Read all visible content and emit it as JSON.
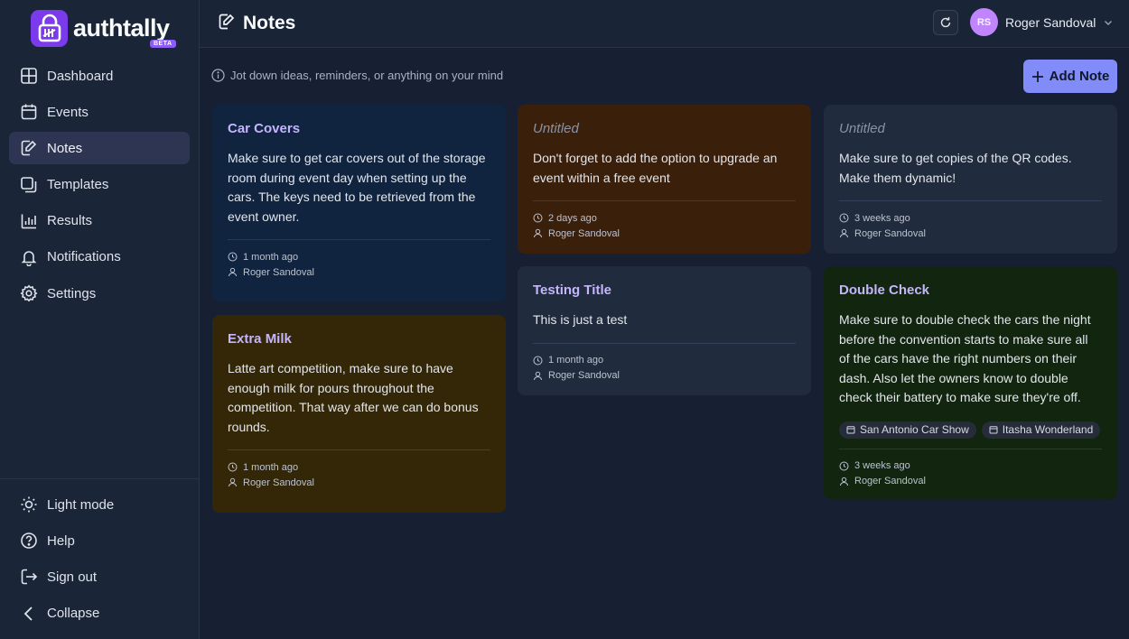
{
  "brand": {
    "name": "authtally",
    "badge": "BETA",
    "accent": "#7c3aed"
  },
  "sidebar": {
    "items": [
      {
        "label": "Dashboard",
        "icon": "dashboard-icon"
      },
      {
        "label": "Events",
        "icon": "calendar-icon"
      },
      {
        "label": "Notes",
        "icon": "notes-icon",
        "active": true
      },
      {
        "label": "Templates",
        "icon": "templates-icon"
      },
      {
        "label": "Results",
        "icon": "bar-chart-icon"
      },
      {
        "label": "Notifications",
        "icon": "bell-icon"
      },
      {
        "label": "Settings",
        "icon": "gear-icon"
      }
    ],
    "bottom": [
      {
        "label": "Light mode",
        "icon": "sun-icon"
      },
      {
        "label": "Help",
        "icon": "help-icon"
      },
      {
        "label": "Sign out",
        "icon": "sign-out-icon"
      },
      {
        "label": "Collapse",
        "icon": "chevron-left-icon"
      }
    ]
  },
  "header": {
    "title": "Notes",
    "user": {
      "initials": "RS",
      "name": "Roger Sandoval"
    }
  },
  "subheader": {
    "hint": "Jot down ideas, reminders, or anything on your mind",
    "add_label": "Add Note"
  },
  "notes": [
    {
      "title": "Car Covers",
      "body": "Make sure to get car covers out of the storage room during event day when setting up the cars. The keys need to be retrieved from the event owner.",
      "time": "1 month ago",
      "author": "Roger Sandoval",
      "color": "#10233f"
    },
    {
      "title": "Extra Milk",
      "body": "Latte art competition, make sure to have enough milk for pours throughout the competition. That way after we can do bonus rounds.",
      "time": "1 month ago",
      "author": "Roger Sandoval",
      "color": "#342708"
    },
    {
      "title": "Untitled",
      "body": "Don't forget to add the option to upgrade an event within a free event",
      "time": "2 days ago",
      "author": "Roger Sandoval",
      "color": "#3a1f0b"
    },
    {
      "title": "Testing Title",
      "body": "This is just a test",
      "time": "1 month ago",
      "author": "Roger Sandoval",
      "color": "#202b3d"
    },
    {
      "title": "Untitled",
      "body": "Make sure to get copies of the QR codes. Make them dynamic!",
      "time": "3 weeks ago",
      "author": "Roger Sandoval",
      "color": "#202b3d"
    },
    {
      "title": "Double Check",
      "body": "Make sure to double check the cars the night before the convention starts to make sure all of the cars have the right numbers on their dash. Also let the owners know to double check their battery to make sure they're off.",
      "tags": [
        "San Antonio Car Show",
        "Itasha Wonderland"
      ],
      "time": "3 weeks ago",
      "author": "Roger Sandoval",
      "color": "#11250f"
    }
  ]
}
